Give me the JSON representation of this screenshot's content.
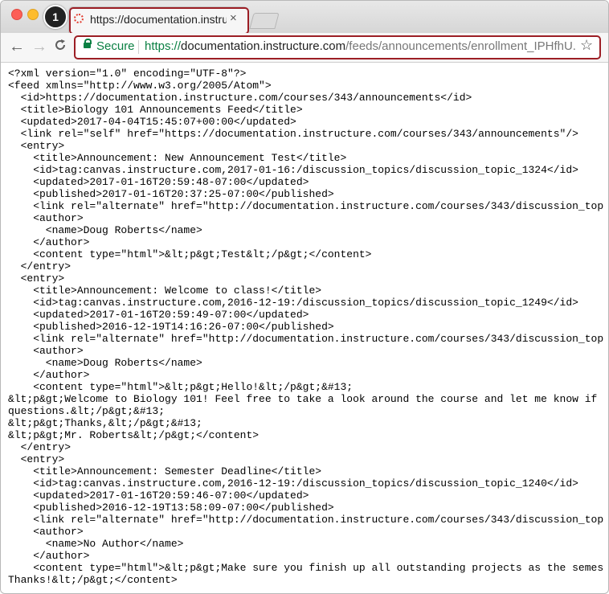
{
  "browser": {
    "tab": {
      "title": "https://documentation.instructure.com/",
      "close": "×"
    },
    "badge": "1",
    "nav": {
      "back": "←",
      "forward": "→",
      "reload": "C"
    },
    "address": {
      "secure_label": "Secure",
      "scheme": "https://",
      "host": "documentation.instructure.com",
      "path": "/feeds/announcements/enrollment_IPHfhU...",
      "star": "☆"
    }
  },
  "xml_lines": [
    "<?xml version=\"1.0\" encoding=\"UTF-8\"?>",
    "<feed xmlns=\"http://www.w3.org/2005/Atom\">",
    "  <id>https://documentation.instructure.com/courses/343/announcements</id>",
    "  <title>Biology 101 Announcements Feed</title>",
    "  <updated>2017-04-04T15:45:07+00:00</updated>",
    "  <link rel=\"self\" href=\"https://documentation.instructure.com/courses/343/announcements\"/>",
    "  <entry>",
    "    <title>Announcement: New Announcement Test</title>",
    "    <id>tag:canvas.instructure.com,2017-01-16:/discussion_topics/discussion_topic_1324</id>",
    "    <updated>2017-01-16T20:59:48-07:00</updated>",
    "    <published>2017-01-16T20:37:25-07:00</published>",
    "    <link rel=\"alternate\" href=\"http://documentation.instructure.com/courses/343/discussion_top",
    "    <author>",
    "      <name>Doug Roberts</name>",
    "    </author>",
    "    <content type=\"html\">&lt;p&gt;Test&lt;/p&gt;</content>",
    "  </entry>",
    "  <entry>",
    "    <title>Announcement: Welcome to class!</title>",
    "    <id>tag:canvas.instructure.com,2016-12-19:/discussion_topics/discussion_topic_1249</id>",
    "    <updated>2017-01-16T20:59:49-07:00</updated>",
    "    <published>2016-12-19T14:16:26-07:00</published>",
    "    <link rel=\"alternate\" href=\"http://documentation.instructure.com/courses/343/discussion_top",
    "    <author>",
    "      <name>Doug Roberts</name>",
    "    </author>",
    "    <content type=\"html\">&lt;p&gt;Hello!&lt;/p&gt;&#13;",
    "&lt;p&gt;Welcome to Biology 101! Feel free to take a look around the course and let me know if",
    "questions.&lt;/p&gt;&#13;",
    "&lt;p&gt;Thanks,&lt;/p&gt;&#13;",
    "&lt;p&gt;Mr. Roberts&lt;/p&gt;</content>",
    "  </entry>",
    "  <entry>",
    "    <title>Announcement: Semester Deadline</title>",
    "    <id>tag:canvas.instructure.com,2016-12-19:/discussion_topics/discussion_topic_1240</id>",
    "    <updated>2017-01-16T20:59:46-07:00</updated>",
    "    <published>2016-12-19T13:58:09-07:00</published>",
    "    <link rel=\"alternate\" href=\"http://documentation.instructure.com/courses/343/discussion_top",
    "    <author>",
    "      <name>No Author</name>",
    "    </author>",
    "    <content type=\"html\">&lt;p&gt;Make sure you finish up all outstanding projects as the semes",
    "Thanks!&lt;/p&gt;</content>"
  ]
}
